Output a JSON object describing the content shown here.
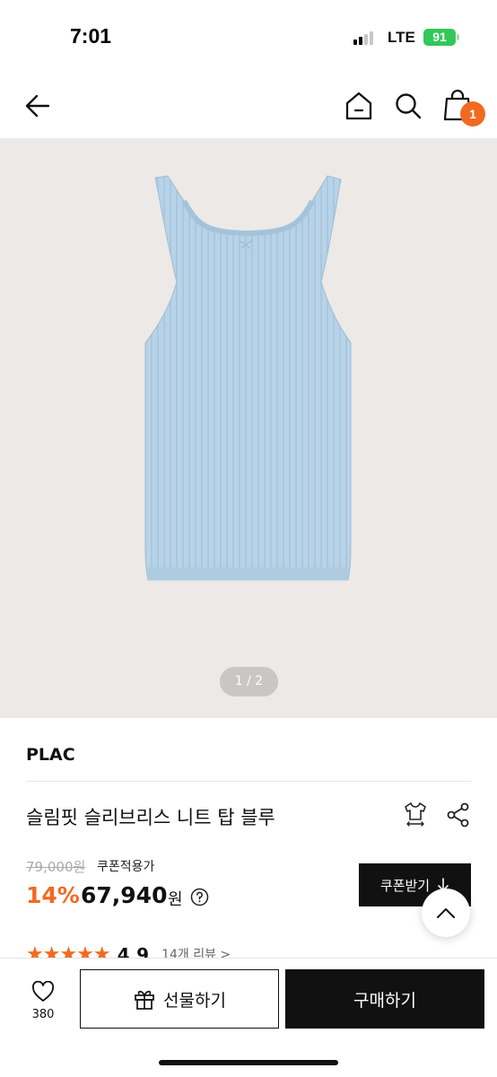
{
  "status_bar": {
    "time": "7:01",
    "network": "LTE",
    "battery": "91"
  },
  "nav": {
    "back_icon": "arrow-left-icon",
    "home_icon": "home-icon",
    "search_icon": "search-icon",
    "cart_icon": "shopping-bag-icon",
    "cart_count": "1"
  },
  "gallery": {
    "page_indicator": "1 / 2",
    "image_color": "#b7d2e6",
    "background": "#ece9e6"
  },
  "product": {
    "brand": "PLAC",
    "title": "슬림핏 슬리브리스 니트 탑 블루",
    "original_price": "79,000원",
    "coupon_note": "쿠폰적용가",
    "discount_rate": "14%",
    "sale_price": "67,940",
    "currency_unit": "원",
    "rating": "4.9",
    "rating_stars": 5,
    "reviews": "14개 리뷰  >"
  },
  "actions": {
    "coupon_button": "쿠폰받기",
    "like_count": "380",
    "gift_button": "선물하기",
    "buy_button": "구매하기"
  },
  "colors": {
    "accent": "#f26a21",
    "dark": "#111111",
    "battery_green": "#34c759"
  }
}
